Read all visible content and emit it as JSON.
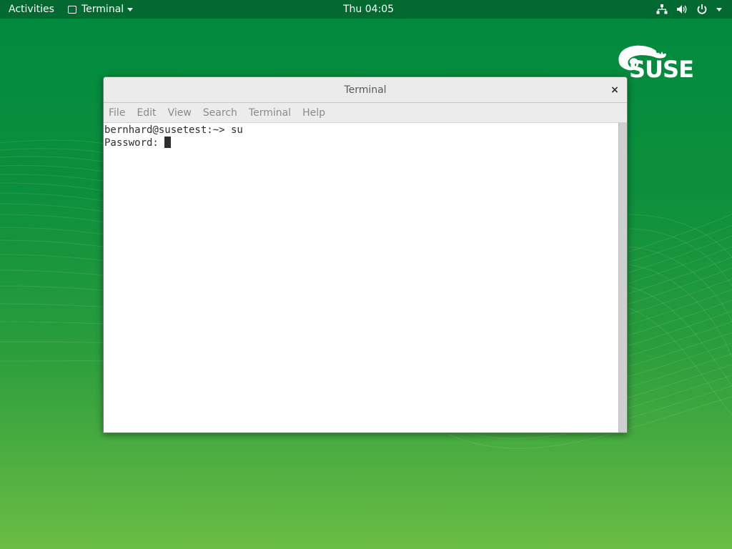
{
  "topbar": {
    "activities": "Activities",
    "app_name": "Terminal",
    "clock": "Thu 04:05",
    "icons": [
      "network-icon",
      "volume-icon",
      "power-icon",
      "chevron-down-icon"
    ]
  },
  "logo": {
    "brand": "SUSE",
    "icon": "chameleon-icon"
  },
  "window": {
    "title": "Terminal",
    "close_label": "×",
    "menu": [
      "File",
      "Edit",
      "View",
      "Search",
      "Terminal",
      "Help"
    ],
    "lines": [
      "bernhard@susetest:~> su",
      "Password: "
    ]
  },
  "colors": {
    "topbar": "#026a30",
    "desktop_top": "#008a3e",
    "desktop_bottom": "#6abd44",
    "menu_text": "#8a8a8a",
    "terminal_text": "#2e2e2e"
  }
}
